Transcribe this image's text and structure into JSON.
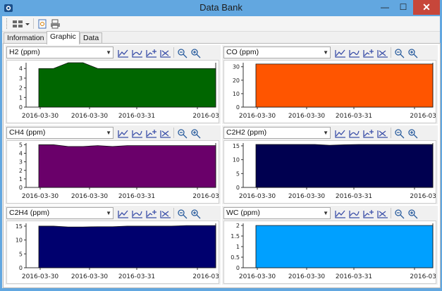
{
  "window": {
    "title": "Data Bank",
    "controls": {
      "minimize": "—",
      "maximize": "☐",
      "close": "✕"
    }
  },
  "tabs": [
    "Information",
    "Graphic",
    "Data"
  ],
  "active_tab": "Graphic",
  "x_ticks": [
    "2016-03-30",
    "2016-03-30",
    "2016-03-31",
    "2016-03"
  ],
  "chart_data": [
    {
      "type": "area",
      "series": [
        {
          "name": "H2 (ppm)",
          "values": [
            4,
            4,
            4.6,
            4.6,
            4,
            4,
            4,
            4,
            4,
            4,
            4,
            4,
            4
          ]
        }
      ],
      "ylim": [
        0,
        4.6
      ],
      "yticks": [
        0,
        1,
        2,
        3,
        4
      ],
      "color": "#006600"
    },
    {
      "type": "area",
      "series": [
        {
          "name": "CO (ppm)",
          "values": [
            32,
            32,
            32,
            32,
            32,
            32,
            32,
            32,
            32,
            32,
            32,
            32,
            32
          ]
        }
      ],
      "ylim": [
        0,
        33
      ],
      "yticks": [
        0,
        10,
        20,
        30
      ],
      "color": "#ff5500"
    },
    {
      "type": "area",
      "series": [
        {
          "name": "CH4 (ppm)",
          "values": [
            5,
            5,
            4.8,
            4.8,
            4.9,
            4.8,
            4.9,
            4.9,
            4.9,
            4.9,
            4.9,
            4.9,
            4.9
          ]
        }
      ],
      "ylim": [
        0,
        5.2
      ],
      "yticks": [
        0,
        1,
        2,
        3,
        4,
        5
      ],
      "color": "#6a006a"
    },
    {
      "type": "area",
      "series": [
        {
          "name": "C2H2 (ppm)",
          "values": [
            15.5,
            15.5,
            15.5,
            15.5,
            15.5,
            15.2,
            15.4,
            15.5,
            15.5,
            15.5,
            15.5,
            15.5,
            15.5
          ]
        }
      ],
      "ylim": [
        0,
        16
      ],
      "yticks": [
        0,
        5,
        10,
        15
      ],
      "color": "#000050"
    },
    {
      "type": "area",
      "series": [
        {
          "name": "C2H4 (ppm)",
          "values": [
            15,
            15,
            14.7,
            14.7,
            14.8,
            14.8,
            15,
            15,
            15,
            15,
            15.2,
            15.2,
            15.2
          ]
        }
      ],
      "ylim": [
        0,
        16
      ],
      "yticks": [
        0,
        5,
        10,
        15
      ],
      "color": "#00006e"
    },
    {
      "type": "area",
      "series": [
        {
          "name": "WC (ppm)",
          "values": [
            2,
            2,
            2,
            2,
            2,
            2,
            2,
            2,
            2,
            2,
            2,
            2,
            2
          ]
        }
      ],
      "ylim": [
        0,
        2.1
      ],
      "yticks": [
        0,
        0.5,
        1,
        1.5,
        2
      ],
      "color": "#00a0ff"
    }
  ]
}
